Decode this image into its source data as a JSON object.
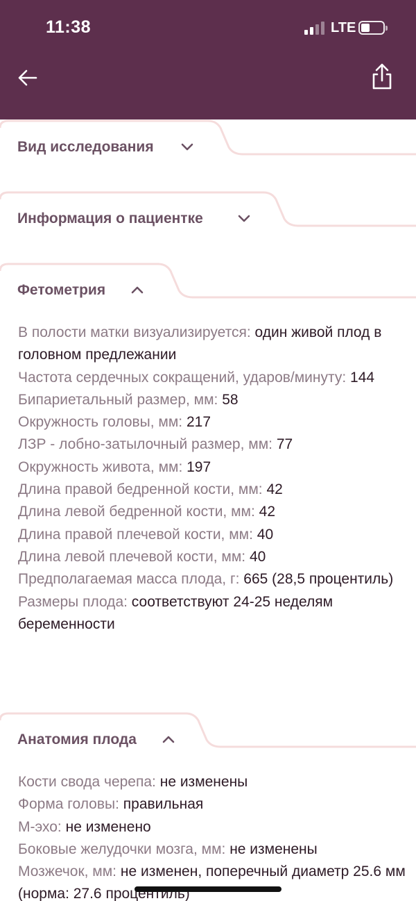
{
  "status_bar": {
    "time": "11:38",
    "network": "LTE"
  },
  "sections": {
    "study_type": {
      "title": "Вид исследования"
    },
    "patient_info": {
      "title": "Информация о пациентке"
    },
    "fetometry": {
      "title": "Фетометрия",
      "rows": [
        {
          "label": "В полости матки визуализируется:",
          "value": "один живой плод в головном предлежании"
        },
        {
          "label": "Частота сердечных сокращений, ударов/минуту:",
          "value": "144"
        },
        {
          "label": "Бипариетальный размер, мм:",
          "value": "58"
        },
        {
          "label": "Окружность головы, мм:",
          "value": "217"
        },
        {
          "label": "ЛЗР - лобно-затылочный размер, мм:",
          "value": "77"
        },
        {
          "label": "Окружность живота, мм:",
          "value": "197"
        },
        {
          "label": "Длина правой бедренной кости, мм:",
          "value": "42"
        },
        {
          "label": "Длина левой бедренной кости, мм:",
          "value": "42"
        },
        {
          "label": "Длина правой плечевой кости, мм:",
          "value": "40"
        },
        {
          "label": "Длина левой плечевой кости, мм:",
          "value": "40"
        },
        {
          "label": "Предполагаемая масса плода, г:",
          "value": "665 (28,5 процентиль)"
        },
        {
          "label": "Размеры плода:",
          "value": "соответствуют  24-25  неделям беременности"
        }
      ]
    },
    "anatomy": {
      "title": "Анатомия плода",
      "rows": [
        {
          "label": "Кости свода черепа:",
          "value": "не изменены"
        },
        {
          "label": "Форма головы:",
          "value": "правильная"
        },
        {
          "label": "М-эхо:",
          "value": "не изменено"
        },
        {
          "label": "Боковые желудочки мозга, мм:",
          "value": "не изменены"
        },
        {
          "label": "Мозжечок, мм:",
          "value": "не изменен, поперечный диаметр 25.6 мм (норма: 27.6 процентиль)"
        }
      ]
    }
  },
  "colors": {
    "header": "#5d2f4d",
    "label": "#8c7a85",
    "value": "#2d1a26",
    "title": "#6b5163",
    "tab_border": "#f5dcdc"
  },
  "icons": {
    "back": "arrow-left-icon",
    "share": "share-icon",
    "collapsed": "chevron-down-icon",
    "expanded": "chevron-up-icon"
  }
}
